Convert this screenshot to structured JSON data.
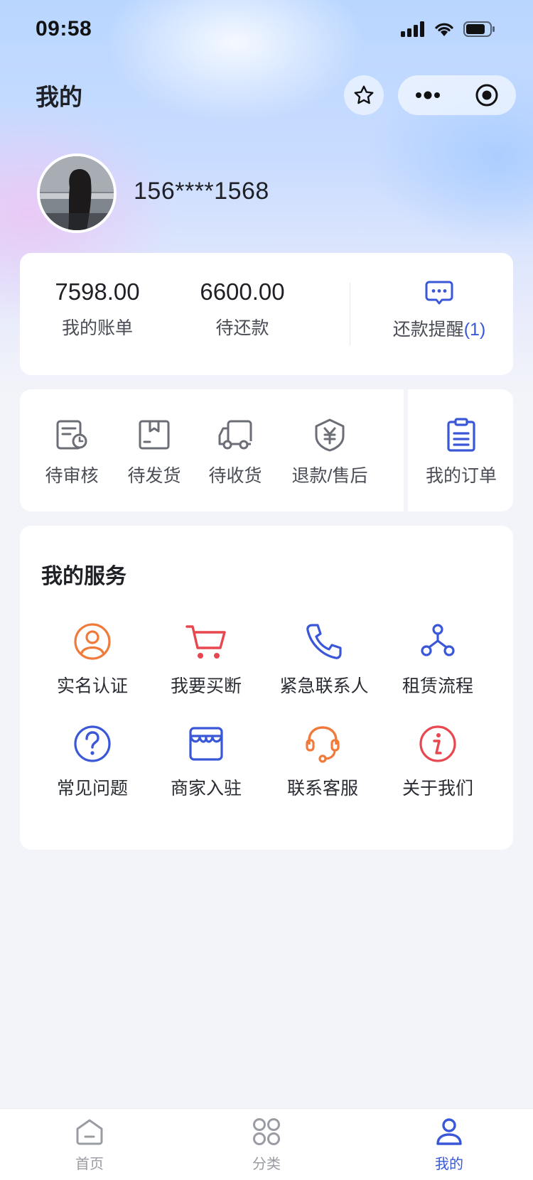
{
  "status_bar": {
    "time": "09:58"
  },
  "header": {
    "title": "我的"
  },
  "profile": {
    "username": "156****1568"
  },
  "bill": {
    "items": [
      {
        "value": "7598.00",
        "label": "我的账单"
      },
      {
        "value": "6600.00",
        "label": "待还款"
      }
    ],
    "remind": {
      "label": "还款提醒",
      "count": "(1)"
    }
  },
  "orders": {
    "items": [
      {
        "label": "待审核",
        "icon": "pending-review-icon"
      },
      {
        "label": "待发货",
        "icon": "box-icon"
      },
      {
        "label": "待收货",
        "icon": "truck-icon"
      },
      {
        "label": "退款/售后",
        "icon": "refund-shield-icon"
      }
    ],
    "my_orders": {
      "label": "我的订单",
      "icon": "clipboard-icon"
    }
  },
  "services": {
    "title": "我的服务",
    "items": [
      {
        "label": "实名认证",
        "icon": "user-verify-icon",
        "color": "#f07a3a"
      },
      {
        "label": "我要买断",
        "icon": "cart-icon",
        "color": "#e8474f"
      },
      {
        "label": "紧急联系人",
        "icon": "phone-icon",
        "color": "#3a57d8"
      },
      {
        "label": "租赁流程",
        "icon": "flow-icon",
        "color": "#3a57d8"
      },
      {
        "label": "常见问题",
        "icon": "question-icon",
        "color": "#3a57d8"
      },
      {
        "label": "商家入驻",
        "icon": "store-icon",
        "color": "#3a57d8"
      },
      {
        "label": "联系客服",
        "icon": "headset-icon",
        "color": "#f07a3a"
      },
      {
        "label": "关于我们",
        "icon": "info-icon",
        "color": "#e8474f"
      }
    ]
  },
  "tabbar": {
    "items": [
      {
        "label": "首页",
        "icon": "home-icon",
        "active": false
      },
      {
        "label": "分类",
        "icon": "category-icon",
        "active": false
      },
      {
        "label": "我的",
        "icon": "user-icon",
        "active": true
      }
    ]
  },
  "colors": {
    "accent": "#3a57d8",
    "orange": "#f07a3a",
    "red": "#e8474f",
    "gray_icon": "#6b6e76"
  }
}
